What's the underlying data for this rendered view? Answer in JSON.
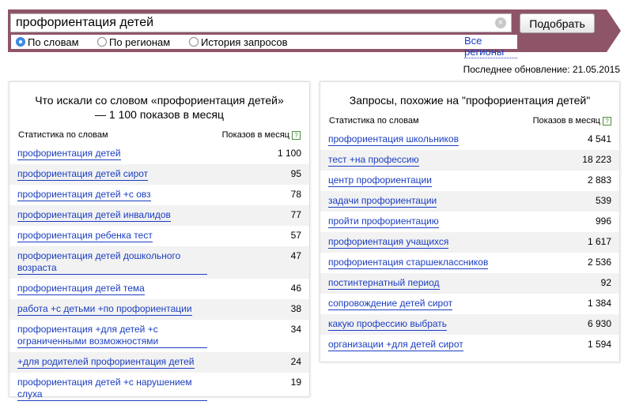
{
  "search": {
    "value": "профориентация детей",
    "submit_label": "Подобрать",
    "clear_icon": "clear-icon"
  },
  "modes": [
    {
      "label": "По словам",
      "checked": true
    },
    {
      "label": "По регионам",
      "checked": false
    },
    {
      "label": "История запросов",
      "checked": false
    }
  ],
  "regions_link": "Все регионы",
  "last_update": "Последнее обновление: 21.05.2015",
  "left_panel": {
    "title": "Что искали со словом «профориентация детей» — 1 100 показов в месяц",
    "col_phrase": "Статистика по словам",
    "col_count": "Показов в месяц",
    "rows": [
      {
        "phrase": "профориентация детей",
        "count": "1 100"
      },
      {
        "phrase": "профориентация детей сирот",
        "count": "95"
      },
      {
        "phrase": "профориентация детей +с овз",
        "count": "78"
      },
      {
        "phrase": "профориентация детей инвалидов",
        "count": "77"
      },
      {
        "phrase": "профориентация ребенка тест",
        "count": "57"
      },
      {
        "phrase": "профориентация детей дошкольного возраста",
        "count": "47"
      },
      {
        "phrase": "профориентация детей тема",
        "count": "46"
      },
      {
        "phrase": "работа +с детьми +по профориентации",
        "count": "38"
      },
      {
        "phrase": "профориентация +для детей +с ограниченными возможностями",
        "count": "34"
      },
      {
        "phrase": "+для родителей профориентация детей",
        "count": "24"
      },
      {
        "phrase": "профориентация детей +с нарушением слуха",
        "count": "19"
      }
    ]
  },
  "right_panel": {
    "title": "Запросы, похожие на \"профориентация детей\"",
    "col_phrase": "Статистика по словам",
    "col_count": "Показов в месяц",
    "rows": [
      {
        "phrase": "профориентация школьников",
        "count": "4 541"
      },
      {
        "phrase": "тест +на профессию",
        "count": "18 223"
      },
      {
        "phrase": "центр профориентации",
        "count": "2 883"
      },
      {
        "phrase": "задачи профориентации",
        "count": "539"
      },
      {
        "phrase": "пройти профориентацию",
        "count": "996"
      },
      {
        "phrase": "профориентация учащихся",
        "count": "1 617"
      },
      {
        "phrase": "профориентация старшеклассников",
        "count": "2 536"
      },
      {
        "phrase": "постинтернатный период",
        "count": "92"
      },
      {
        "phrase": "сопровождение детей сирот",
        "count": "1 384"
      },
      {
        "phrase": "какую профессию выбрать",
        "count": "6 930"
      },
      {
        "phrase": "организации +для детей сирот",
        "count": "1 594"
      }
    ]
  },
  "colors": {
    "band": "#8e5569",
    "link": "#1a3dc1",
    "row_alt": "#f2f2f2"
  }
}
